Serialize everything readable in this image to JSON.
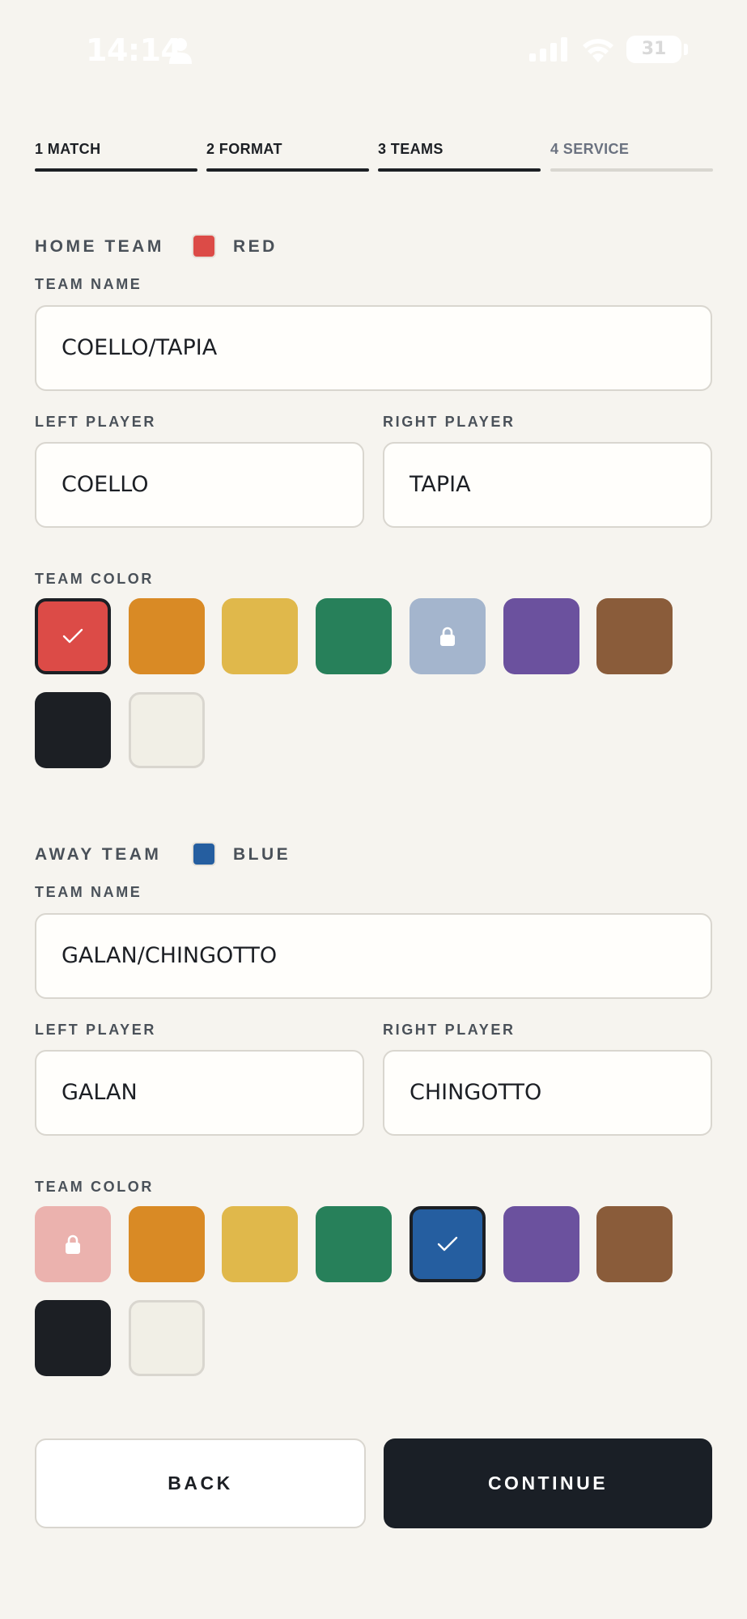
{
  "status_bar": {
    "time": "14:14",
    "battery": "31"
  },
  "stepper": [
    {
      "label": "1 MATCH",
      "state": "done"
    },
    {
      "label": "2 FORMAT",
      "state": "done"
    },
    {
      "label": "3 TEAMS",
      "state": "done"
    },
    {
      "label": "4 SERVICE",
      "state": "todo"
    }
  ],
  "home": {
    "heading": "HOME TEAM",
    "color_name": "RED",
    "color_hex": "#dc4b47",
    "team_name_label": "TEAM NAME",
    "team_name": "COELLO/TAPIA",
    "left_player_label": "LEFT PLAYER",
    "left_player": "COELLO",
    "right_player_label": "RIGHT PLAYER",
    "right_player": "TAPIA",
    "team_color_label": "TEAM COLOR",
    "swatches": [
      {
        "name": "red",
        "hex": "#dc4b47",
        "state": "selected"
      },
      {
        "name": "orange",
        "hex": "#d98a25",
        "state": "available"
      },
      {
        "name": "yellow",
        "hex": "#e0b84b",
        "state": "available"
      },
      {
        "name": "green",
        "hex": "#27805a",
        "state": "available"
      },
      {
        "name": "blue",
        "hex": "#a4b5cd",
        "state": "locked"
      },
      {
        "name": "purple",
        "hex": "#6b519e",
        "state": "available"
      },
      {
        "name": "brown",
        "hex": "#8a5c3a",
        "state": "available"
      },
      {
        "name": "black",
        "hex": "#1c1f24",
        "state": "available"
      },
      {
        "name": "white",
        "hex": "#f1efe6",
        "state": "available"
      }
    ]
  },
  "away": {
    "heading": "AWAY TEAM",
    "color_name": "BLUE",
    "color_hex": "#255ea0",
    "team_name_label": "TEAM NAME",
    "team_name": "GALAN/CHINGOTTO",
    "left_player_label": "LEFT PLAYER",
    "left_player": "GALAN",
    "right_player_label": "RIGHT PLAYER",
    "right_player": "CHINGOTTO",
    "team_color_label": "TEAM COLOR",
    "swatches": [
      {
        "name": "red",
        "hex": "#ebb2ae",
        "state": "locked"
      },
      {
        "name": "orange",
        "hex": "#d98a25",
        "state": "available"
      },
      {
        "name": "yellow",
        "hex": "#e0b84b",
        "state": "available"
      },
      {
        "name": "green",
        "hex": "#27805a",
        "state": "available"
      },
      {
        "name": "blue",
        "hex": "#255ea0",
        "state": "selected"
      },
      {
        "name": "purple",
        "hex": "#6b519e",
        "state": "available"
      },
      {
        "name": "brown",
        "hex": "#8a5c3a",
        "state": "available"
      },
      {
        "name": "black",
        "hex": "#1c1f24",
        "state": "available"
      },
      {
        "name": "white",
        "hex": "#f1efe6",
        "state": "available"
      }
    ]
  },
  "actions": {
    "back_label": "BACK",
    "continue_label": "CONTINUE"
  }
}
